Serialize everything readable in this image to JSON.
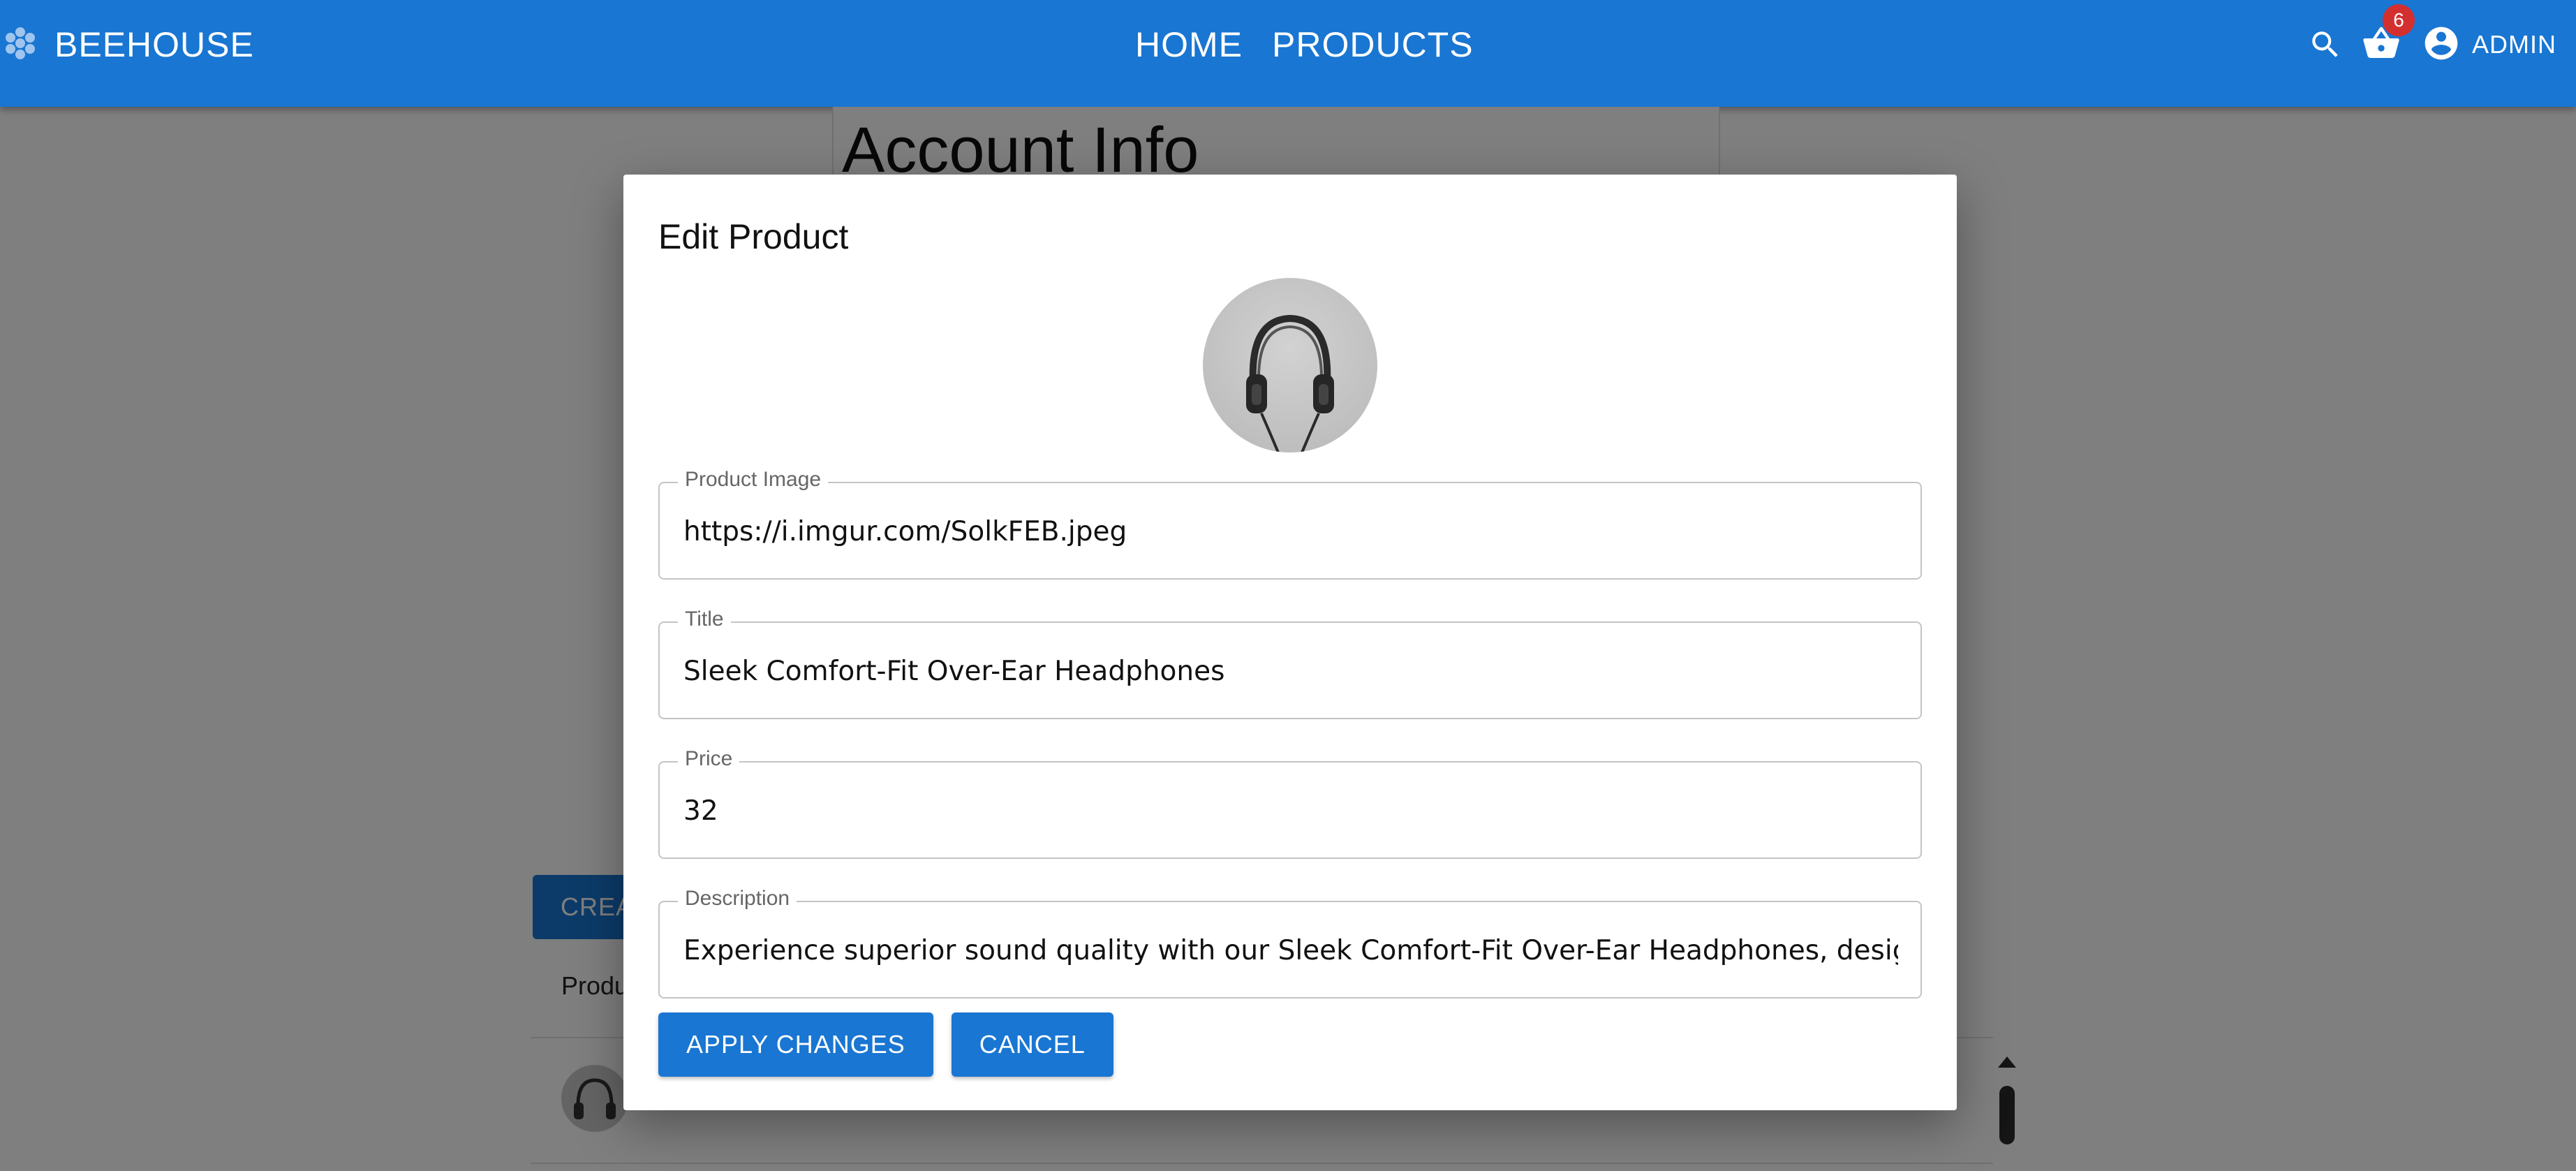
{
  "app": {
    "brand_name": "BEEHOUSE",
    "brand_icon": "hive-icon",
    "primary_color": "#1976d2"
  },
  "nav": {
    "items": [
      {
        "label": "HOME"
      },
      {
        "label": "PRODUCTS"
      }
    ]
  },
  "header_actions": {
    "search_icon": "search-icon",
    "cart_icon": "shopping-basket-icon",
    "cart_badge": "6",
    "user_icon": "account-circle-icon",
    "user_label": "ADMIN"
  },
  "background": {
    "account_title": "Account Info",
    "create_button_label": "CREA",
    "table_header_first": "Produ"
  },
  "dialog": {
    "title": "Edit Product",
    "preview_icon": "headphones-icon",
    "fields": [
      {
        "label": "Product Image",
        "value": "https://i.imgur.com/SolkFEB.jpeg"
      },
      {
        "label": "Title",
        "value": "Sleek Comfort-Fit Over-Ear Headphones"
      },
      {
        "label": "Price",
        "value": "32"
      },
      {
        "label": "Description",
        "value": "Experience superior sound quality with our Sleek Comfort-Fit Over-Ear Headphones, designed for"
      }
    ],
    "apply_label": "APPLY CHANGES",
    "cancel_label": "CANCEL"
  }
}
